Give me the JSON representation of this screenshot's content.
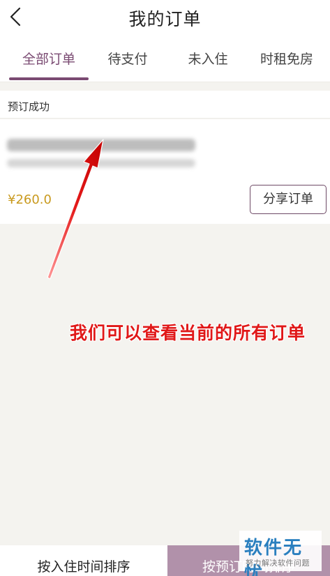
{
  "header": {
    "title": "我的订单",
    "back_icon": "chevron-left-icon"
  },
  "tabs": [
    {
      "label": "全部订单",
      "active": true
    },
    {
      "label": "待支付",
      "active": false
    },
    {
      "label": "未入住",
      "active": false
    },
    {
      "label": "时租免房",
      "active": false
    }
  ],
  "order": {
    "status": "预订成功",
    "price": "¥260.0",
    "share_label": "分享订单"
  },
  "annotation": {
    "text": "我们可以查看当前的所有订单"
  },
  "bottom_bar": {
    "sort_checkin": "按入住时间排序",
    "sort_booking": "按预订时间排序"
  },
  "watermark": {
    "title": "软件无忧",
    "subtitle": "努力解决软件问题"
  },
  "colors": {
    "accent": "#7a4a72",
    "price": "#c99a1f",
    "annotation": "#e01818",
    "bottom_active": "#b191aa"
  }
}
